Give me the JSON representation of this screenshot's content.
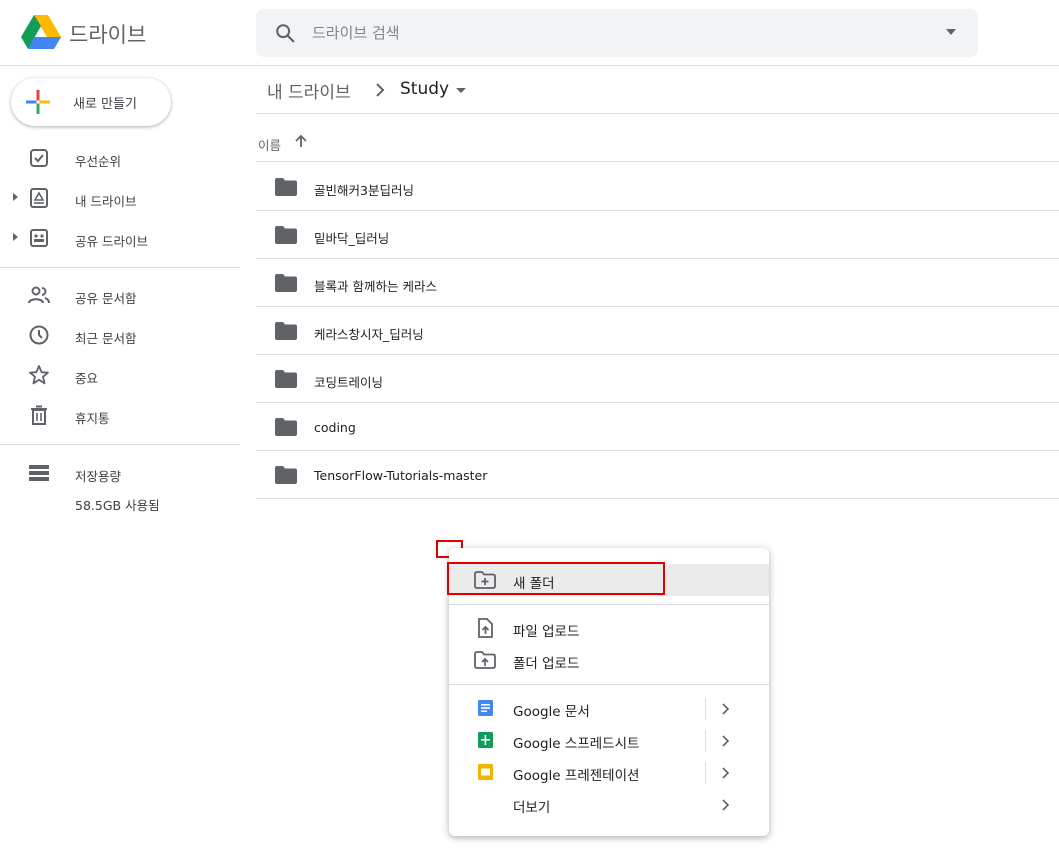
{
  "header": {
    "app_name": "드라이브",
    "search_placeholder": "드라이브 검색"
  },
  "sidebar": {
    "new_button": "새로 만들기",
    "items": [
      {
        "label": "우선순위",
        "icon": "priority-check-icon"
      },
      {
        "label": "내 드라이브",
        "icon": "my-drive-icon"
      },
      {
        "label": "공유 드라이브",
        "icon": "shared-drives-icon"
      },
      {
        "label": "공유 문서함",
        "icon": "shared-with-me-icon"
      },
      {
        "label": "최근 문서함",
        "icon": "recent-clock-icon"
      },
      {
        "label": "중요",
        "icon": "star-icon"
      },
      {
        "label": "휴지통",
        "icon": "trash-icon"
      }
    ],
    "storage": {
      "label": "저장용량",
      "used": "58.5GB 사용됨"
    }
  },
  "breadcrumb": {
    "root": "내 드라이브",
    "current": "Study"
  },
  "list": {
    "column_name": "이름",
    "folders": [
      "골빈해커3분딥러닝",
      "밑바닥_딥러닝",
      "블록과 함께하는 케라스",
      "케라스창시자_딥러닝",
      "코딩트레이닝",
      "coding",
      "TensorFlow-Tutorials-master"
    ]
  },
  "context_menu": {
    "new_folder": "새 폴더",
    "file_upload": "파일 업로드",
    "folder_upload": "폴더 업로드",
    "docs": "Google 문서",
    "sheets": "Google 스프레드시트",
    "slides": "Google 프레젠테이션",
    "more": "더보기"
  },
  "colors": {
    "docs": "#4285f4",
    "sheets": "#0f9d58",
    "slides": "#f4b400",
    "highlight": "#e00000"
  }
}
